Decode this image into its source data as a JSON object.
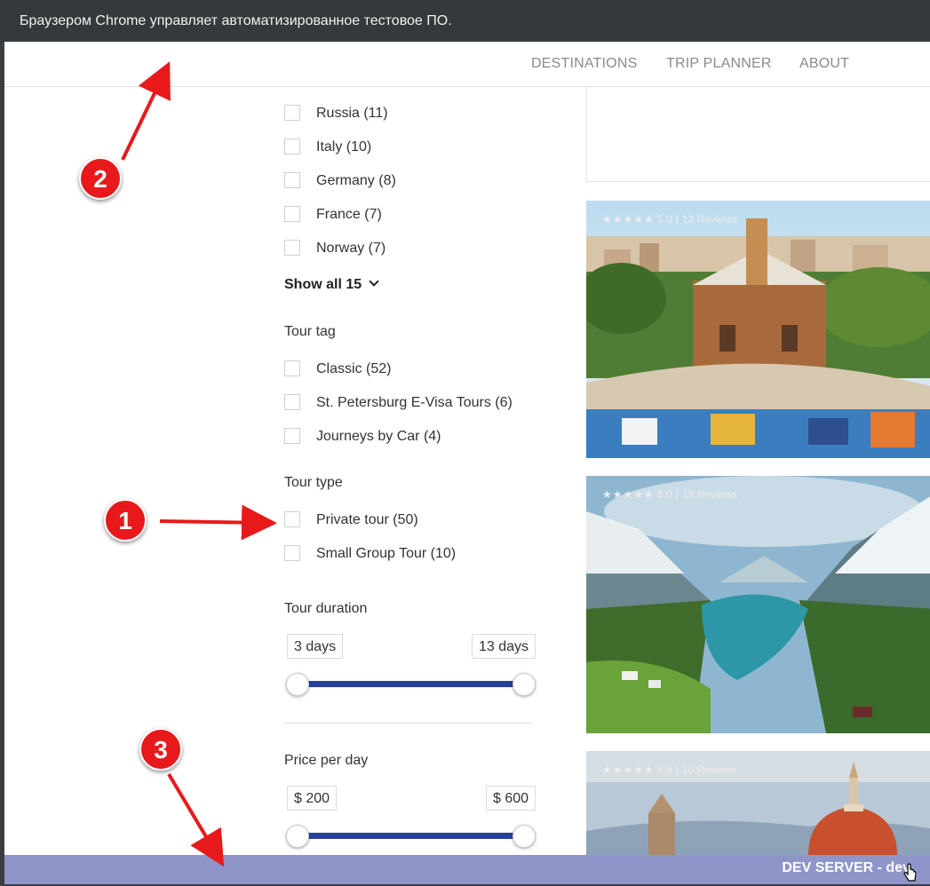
{
  "browser": {
    "infobar_text": "Браузером Chrome управляет автоматизированное тестовое ПО."
  },
  "nav": {
    "items": [
      "DESTINATIONS",
      "TRIP PLANNER",
      "ABOUT"
    ]
  },
  "filters": {
    "countries": [
      {
        "label": "Russia (11)"
      },
      {
        "label": "Italy (10)"
      },
      {
        "label": "Germany (8)"
      },
      {
        "label": "France (7)"
      },
      {
        "label": "Norway (7)"
      }
    ],
    "show_all": "Show all 15",
    "tour_tag": {
      "heading": "Tour tag",
      "items": [
        {
          "label": "Classic (52)"
        },
        {
          "label": "St. Petersburg E-Visa Tours (6)"
        },
        {
          "label": "Journeys by Car (4)"
        }
      ]
    },
    "tour_type": {
      "heading": "Tour type",
      "items": [
        {
          "label": "Private tour (50)"
        },
        {
          "label": "Small Group Tour (10)"
        }
      ]
    },
    "duration": {
      "heading": "Tour duration",
      "min": "3 days",
      "max": "13 days"
    },
    "price": {
      "heading": "Price per day",
      "min": "$ 200",
      "max": "$ 600"
    }
  },
  "cards": [
    {
      "stars": "★★★★★",
      "rating": "5.0",
      "reviews": "12 Reviews"
    },
    {
      "stars": "★★★★★",
      "rating": "5.0",
      "reviews": "18 Reviews"
    },
    {
      "stars": "★★★★★",
      "rating": "4.9",
      "reviews": "10 Reviews"
    }
  ],
  "dev_bar": {
    "text": "DEV SERVER - dev"
  },
  "annotations": {
    "badges": [
      "1",
      "2",
      "3"
    ]
  },
  "colors": {
    "slider": "#26419a",
    "dev_bar": "#8f95c8",
    "annotation": "#e8191b"
  }
}
